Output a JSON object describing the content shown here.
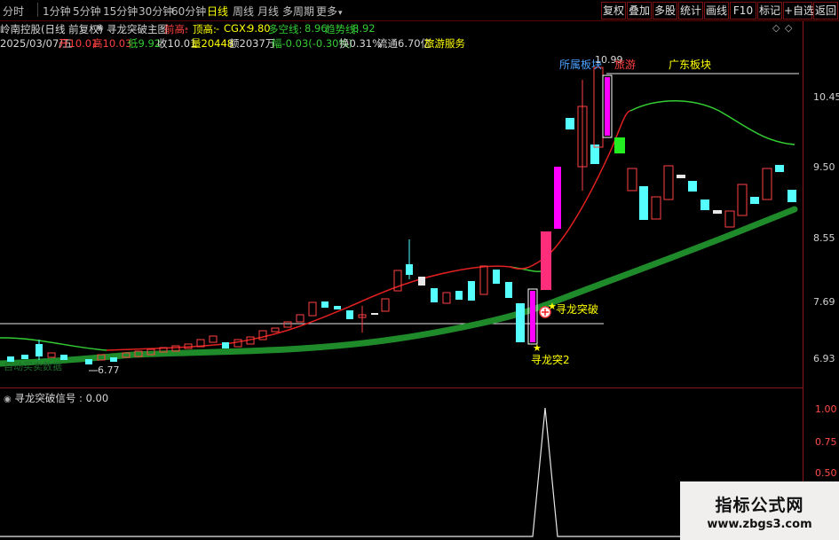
{
  "toolbar": {
    "timeframes": [
      "分时",
      "1分钟",
      "5分钟",
      "15分钟",
      "30分钟",
      "60分钟",
      "日线",
      "周线",
      "月线",
      "多周期",
      "更多"
    ],
    "active_timeframe": "日线",
    "more_arrow": "▾",
    "buttons": [
      "复权",
      "叠加",
      "多股",
      "统计",
      "画线",
      "F10",
      "标记",
      "+自选",
      "返回"
    ]
  },
  "header": {
    "stock_name": "岭南控股(日线 前复权)",
    "indicator_name": "寻龙突破主图",
    "qianxin_label": "前高:",
    "qianxin_value": "-",
    "dinggao_label": "顶高:",
    "dinggao_value": "-",
    "cgx_label": "CGX:",
    "cgx_value": "9.80",
    "duokong_label": "多空线:",
    "duokong_value": "8.96",
    "qushi_label": "趋势线:",
    "qushi_value": "8.92"
  },
  "quote": {
    "date": "2025/03/07/五",
    "open": "开10.01",
    "high": "高10.03",
    "low": "低9.92",
    "close": "收10.01",
    "volume": "量20448",
    "amount": "额2037万",
    "change": "幅-0.03(-0.30%)",
    "turnover": "换0.31%",
    "float": "流通6.70亿",
    "sector": "旅游服务"
  },
  "price_axis": [
    "10.45",
    "9.50",
    "8.55",
    "7.69",
    "6.93"
  ],
  "sub_axis": [
    "1.00",
    "0.75",
    "0.50"
  ],
  "annotations": {
    "sector_label": "所属板块",
    "high_label": "10.99",
    "tourism_label": "旅游",
    "guangdong_label": "广东板块",
    "low_label": "6.77",
    "breakout_label": "寻龙突破",
    "breakout2_label": "寻龙突2",
    "faded_label": "自动买卖数据"
  },
  "sub_indicator": {
    "name": "寻龙突破信号",
    "value": ": 0.00"
  },
  "watermark": {
    "title": "指标公式网",
    "url": "www.zbgs3.com"
  },
  "colors": {
    "up_candle": "#ff4040",
    "down_candle": "#55ffff",
    "signal_bar": "#ff00ff",
    "trend_line": "#1f8a2a",
    "ma_green": "#33cc33",
    "ma_red": "#e02020",
    "axis": "#8b1414"
  }
}
